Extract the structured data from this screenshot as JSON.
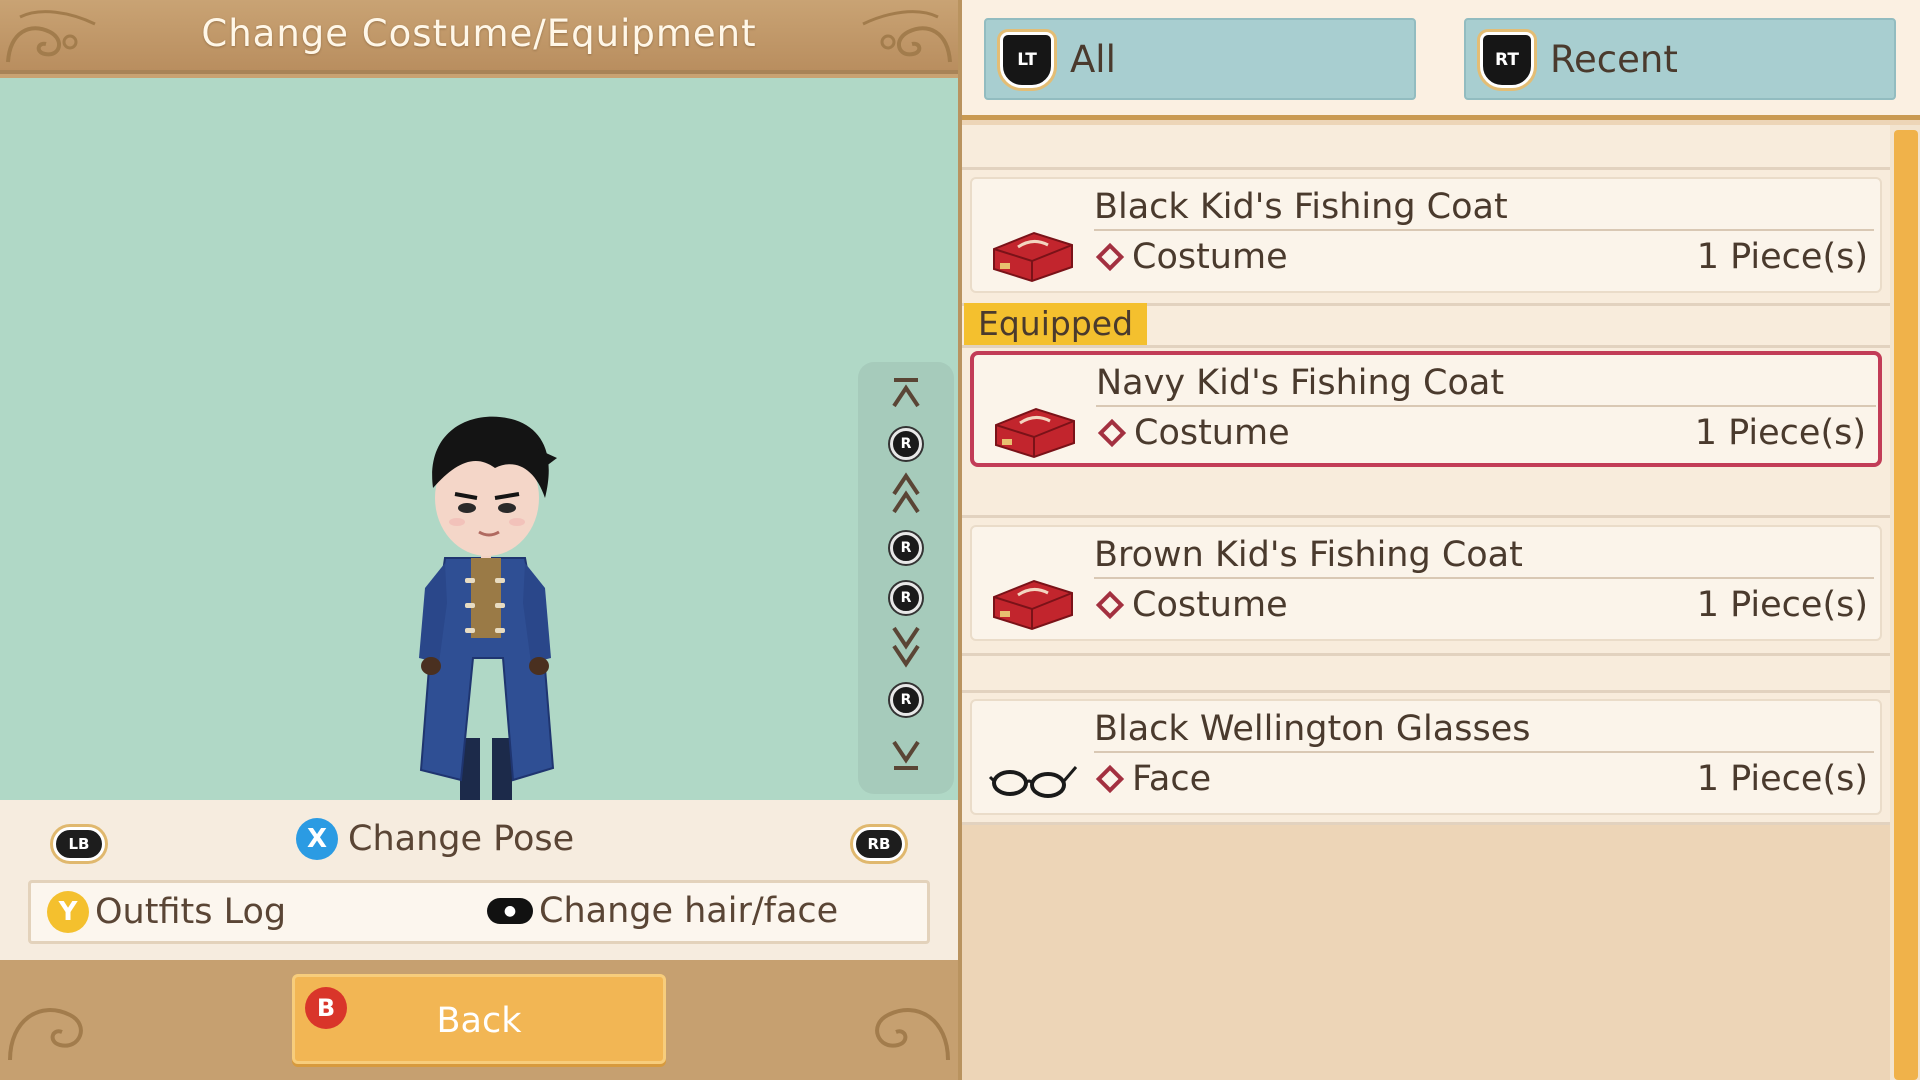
{
  "header": {
    "title": "Change Costume/Equipment"
  },
  "controls": {
    "lb": "LB",
    "rb": "RB",
    "pose_button": "X",
    "pose_label": "Change Pose",
    "outfits_button": "Y",
    "outfits_label": "Outfits Log",
    "hair_label": "Change hair/face",
    "back_button": "B",
    "back_label": "Back"
  },
  "rotation": {
    "stick_label": "R"
  },
  "tabs": [
    {
      "badge": "LT",
      "label": "All"
    },
    {
      "badge": "RT",
      "label": "Recent"
    }
  ],
  "equipped_tag": "Equipped",
  "items": [
    {
      "name": "Black Kid's Fishing Coat",
      "type": "Costume",
      "qty": "1 Piece(s)",
      "icon": "costume-box-icon"
    },
    {
      "name": "Navy Kid's Fishing Coat",
      "type": "Costume",
      "qty": "1 Piece(s)",
      "icon": "costume-box-icon",
      "equipped": true
    },
    {
      "name": "Brown Kid's Fishing Coat",
      "type": "Costume",
      "qty": "1 Piece(s)",
      "icon": "costume-box-icon"
    },
    {
      "name": "Black Wellington Glasses",
      "type": "Face",
      "qty": "1 Piece(s)",
      "icon": "glasses-icon"
    }
  ],
  "colors": {
    "preview_bg": "#b0d8c6",
    "equipped_border": "#c23c57",
    "equipped_tag": "#f4c02e",
    "back_button": "#f2b654",
    "x_button": "#2b9be3",
    "y_button": "#f4c02e",
    "b_button": "#d9352a"
  }
}
